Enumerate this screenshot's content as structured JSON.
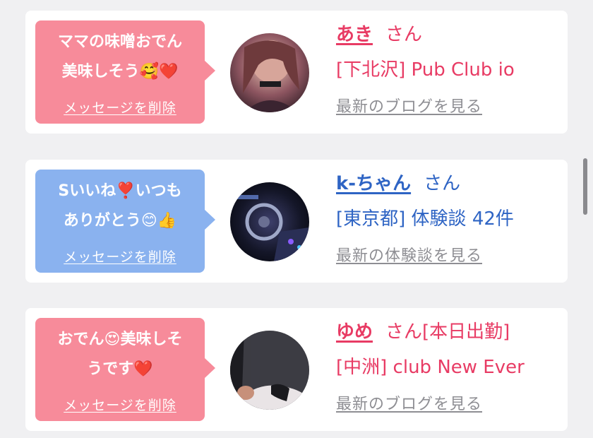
{
  "colors": {
    "pink_bubble": "#f78b9a",
    "blue_bubble": "#8ab2ef",
    "name_red": "#e83b64",
    "name_blue": "#2e64c4",
    "link_gray": "#8e8e93"
  },
  "cards": [
    {
      "message": "ママの味噌おでん\n美味しそう🥰❤️",
      "delete_label": "メッセージを削除",
      "name": "あき",
      "honorific": "さん",
      "subtitle": "[下北沢] Pub Club io",
      "link": "最新のブログを見る"
    },
    {
      "message": "Sいいね❣️いつも\nありがとう😊👍",
      "delete_label": "メッセージを削除",
      "name": "k-ちゃん",
      "honorific": "さん",
      "subtitle": "[東京都] 体験談 42件",
      "link": "最新の体験談を見る"
    },
    {
      "message": "おでん😍美味しそ\nうです❤️",
      "delete_label": "メッセージを削除",
      "name": "ゆめ",
      "honorific": "さん[本日出勤]",
      "subtitle": "[中洲] club New Ever",
      "link": "最新のブログを見る"
    }
  ]
}
